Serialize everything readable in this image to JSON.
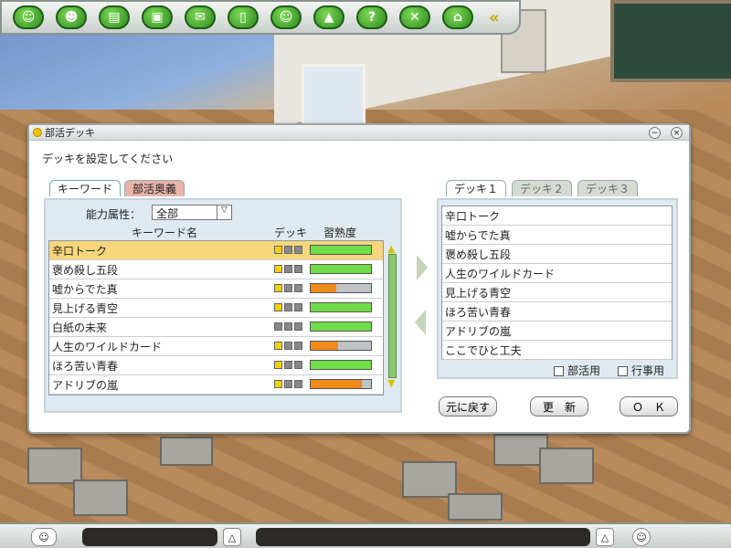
{
  "toolbar": {
    "icons": [
      "character-icon",
      "person-icon",
      "clapper-icon",
      "gift-icon",
      "chat-icon",
      "notebook-icon",
      "friends-icon",
      "building-icon",
      "help-icon",
      "tools-icon",
      "home-icon",
      "collapse-icon"
    ],
    "help_glyph": "?"
  },
  "dialog": {
    "title": "部活デッキ",
    "instruction": "デッキを設定してください",
    "left_tabs": [
      "キーワード",
      "部活奥義"
    ],
    "attr_label": "能力属性：",
    "attr_value": "全部",
    "col_keyword": "キーワード名",
    "col_deck": "デッキ",
    "col_skill": "習熟度",
    "keywords": [
      {
        "name": "辛口トーク",
        "deck": true,
        "skill": 1.0,
        "color": "#6fdc4a",
        "selected": true
      },
      {
        "name": "褒め殺し五段",
        "deck": true,
        "skill": 1.0,
        "color": "#6fdc4a"
      },
      {
        "name": "嘘からでた真",
        "deck": true,
        "skill": 0.42,
        "color": "#f08a1a"
      },
      {
        "name": "見上げる青空",
        "deck": true,
        "skill": 1.0,
        "color": "#6fdc4a"
      },
      {
        "name": "白紙の未来",
        "deck": false,
        "skill": 1.0,
        "color": "#6fdc4a"
      },
      {
        "name": "人生のワイルドカード",
        "deck": true,
        "skill": 0.45,
        "color": "#f08a1a"
      },
      {
        "name": "ほろ苦い青春",
        "deck": true,
        "skill": 1.0,
        "color": "#6fdc4a"
      },
      {
        "name": "アドリブの嵐",
        "deck": true,
        "skill": 0.85,
        "color": "#f08a1a"
      }
    ],
    "deck_tabs": [
      "デッキ１",
      "デッキ２",
      "デッキ３"
    ],
    "deck_items": [
      "辛口トーク",
      "嘘からでた真",
      "褒め殺し五段",
      "人生のワイルドカード",
      "見上げる青空",
      "ほろ苦い青春",
      "アドリブの嵐",
      "ここでひと工夫"
    ],
    "check_club": "部活用",
    "check_event": "行事用",
    "btn_reset": "元に戻す",
    "btn_update": "更　新",
    "btn_ok": "Ｏ　Ｋ"
  }
}
